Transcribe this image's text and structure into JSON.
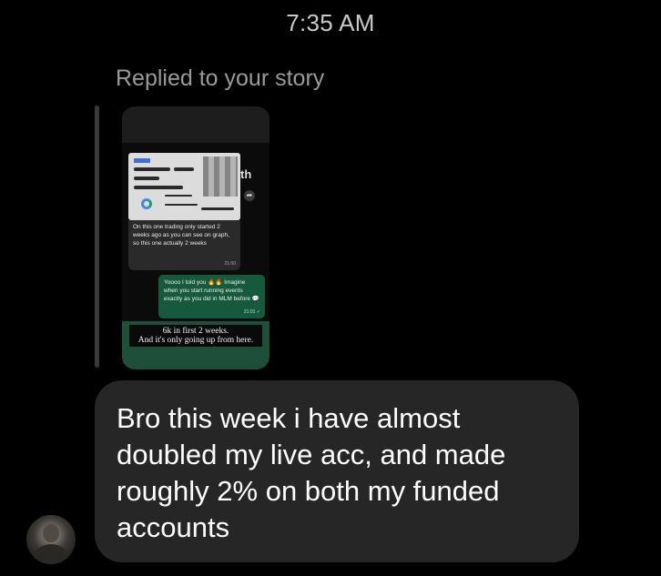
{
  "timestamp": "7:35 AM",
  "reply_label": "Replied to your story",
  "story": {
    "side_text": "th",
    "caption_message": "On this one trading only started 2 weeks ago as you can see on graph, so this one actually 2 weeks",
    "caption_message_time": "21:00",
    "green_message": "Yoooo I told you 🔥🔥 Imagine when you start running events exactly as you did in MLM before 💬",
    "green_message_time": "21:01 ✓",
    "story_caption_line1": "6k in first 2 weeks.",
    "story_caption_line2": "And it's only going up from here."
  },
  "message": {
    "text": "Bro this week i have almost doubled my live acc, and made roughly 2% on both my funded accounts"
  },
  "colors": {
    "background": "#000000",
    "bubble": "#262626",
    "green_bubble": "#155a3c"
  },
  "icons": [
    "forward-icon"
  ]
}
